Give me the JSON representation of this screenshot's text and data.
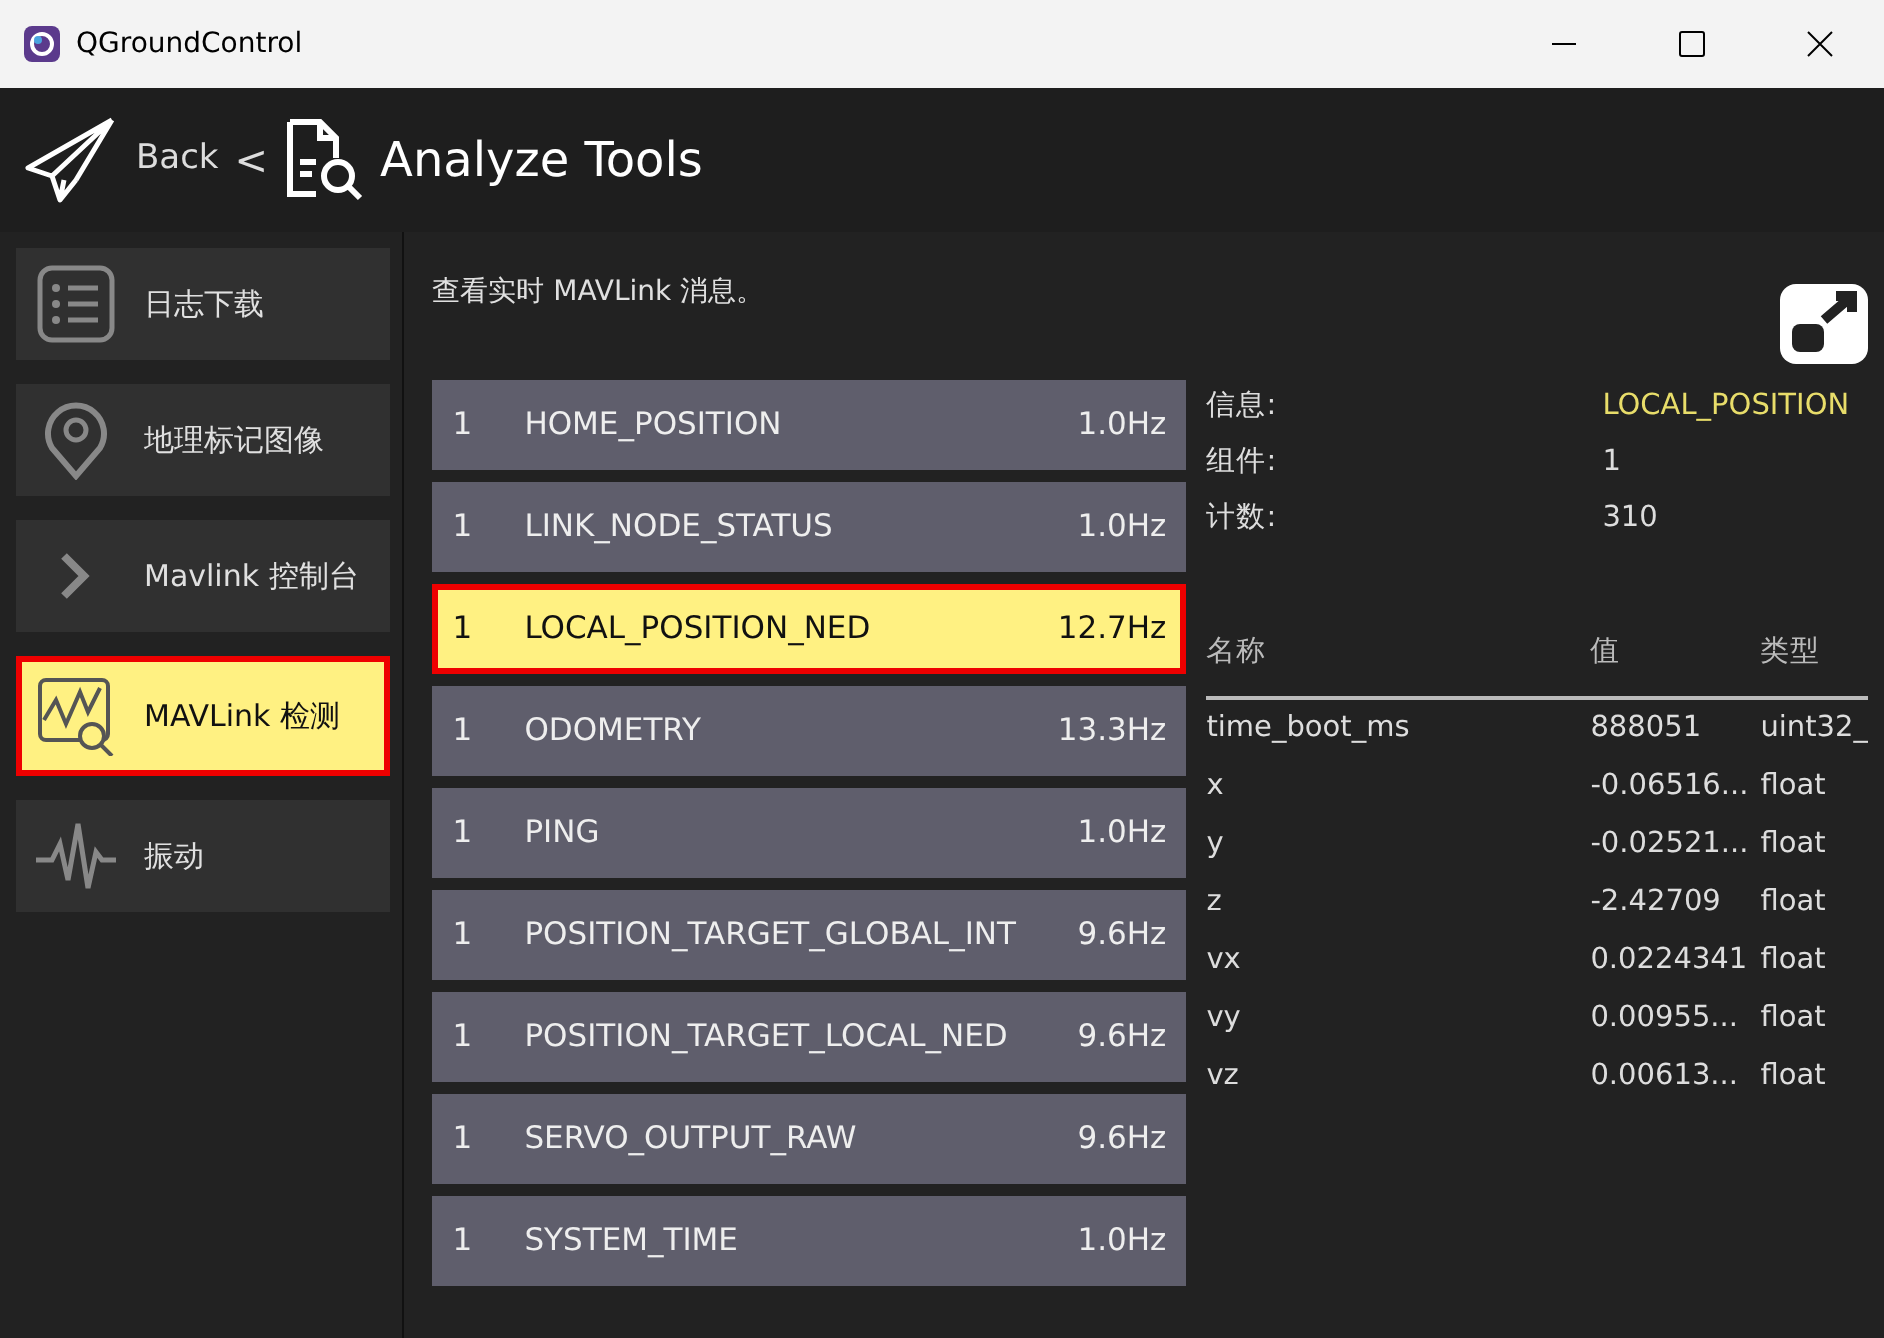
{
  "window": {
    "title": "QGroundControl"
  },
  "toolbar": {
    "back": "Back",
    "separator": "<",
    "title": "Analyze Tools"
  },
  "sidebar": {
    "items": [
      {
        "label": "日志下载",
        "kind": "list",
        "selected": false,
        "outlined": false
      },
      {
        "label": "地理标记图像",
        "kind": "pin",
        "selected": false,
        "outlined": false
      },
      {
        "label": "Mavlink 控制台",
        "kind": "chevron",
        "selected": false,
        "outlined": false
      },
      {
        "label": "MAVLink 检测",
        "kind": "chart",
        "selected": true,
        "outlined": true
      },
      {
        "label": "振动",
        "kind": "wave",
        "selected": false,
        "outlined": false
      }
    ]
  },
  "description": "查看实时 MAVLink 消息。",
  "messages": [
    {
      "component": "1",
      "name": "HOME_POSITION",
      "rate": "1.0Hz",
      "selected": false,
      "outlined": false
    },
    {
      "component": "1",
      "name": "LINK_NODE_STATUS",
      "rate": "1.0Hz",
      "selected": false,
      "outlined": false
    },
    {
      "component": "1",
      "name": "LOCAL_POSITION_NED",
      "rate": "12.7Hz",
      "selected": true,
      "outlined": true
    },
    {
      "component": "1",
      "name": "ODOMETRY",
      "rate": "13.3Hz",
      "selected": false,
      "outlined": false
    },
    {
      "component": "1",
      "name": "PING",
      "rate": "1.0Hz",
      "selected": false,
      "outlined": false
    },
    {
      "component": "1",
      "name": "POSITION_TARGET_GLOBAL_INT",
      "rate": "9.6Hz",
      "selected": false,
      "outlined": false
    },
    {
      "component": "1",
      "name": "POSITION_TARGET_LOCAL_NED",
      "rate": "9.6Hz",
      "selected": false,
      "outlined": false
    },
    {
      "component": "1",
      "name": "SERVO_OUTPUT_RAW",
      "rate": "9.6Hz",
      "selected": false,
      "outlined": false
    },
    {
      "component": "1",
      "name": "SYSTEM_TIME",
      "rate": "1.0Hz",
      "selected": false,
      "outlined": false
    }
  ],
  "details": {
    "info": [
      {
        "label": "信息:",
        "value": "LOCAL_POSITION"
      },
      {
        "label": "组件:",
        "value": "1"
      },
      {
        "label": "计数:",
        "value": "310"
      }
    ],
    "columns": [
      "名称",
      "值",
      "类型"
    ],
    "fields": [
      {
        "name": "time_boot_ms",
        "value": "888051",
        "type": "uint32_"
      },
      {
        "name": "x",
        "value": "-0.06516...",
        "type": "float"
      },
      {
        "name": "y",
        "value": "-0.02521...",
        "type": "float"
      },
      {
        "name": "z",
        "value": "-2.42709",
        "type": "float"
      },
      {
        "name": "vx",
        "value": "0.0224341",
        "type": "float"
      },
      {
        "name": "vy",
        "value": "0.00955...",
        "type": "float"
      },
      {
        "name": "vz",
        "value": "0.00613...",
        "type": "float"
      }
    ]
  }
}
